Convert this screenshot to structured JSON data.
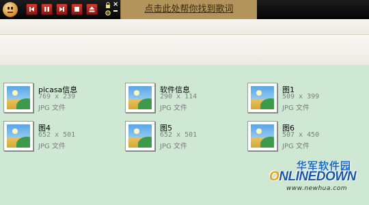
{
  "player": {
    "logo_icon": "player-mascot-icon",
    "buttons": [
      {
        "name": "prev-track-button",
        "icon": "skip-back-icon"
      },
      {
        "name": "pause-button",
        "icon": "pause-icon"
      },
      {
        "name": "next-track-button",
        "icon": "skip-forward-icon"
      },
      {
        "name": "stop-button",
        "icon": "stop-icon"
      },
      {
        "name": "eject-button",
        "icon": "eject-icon"
      }
    ],
    "promo_text": "点击此处帮你找到歌词",
    "accent_color": "#c8281c"
  },
  "files": [
    {
      "name": "picasa信息",
      "dims": "769 x 239",
      "type": "JPG 文件"
    },
    {
      "name": "软件信息",
      "dims": "290 x 114",
      "type": "JPG 文件"
    },
    {
      "name": "图1",
      "dims": "509 x 399",
      "type": "JPG 文件"
    },
    {
      "name": "图4",
      "dims": "652 x 501",
      "type": "JPG 文件"
    },
    {
      "name": "图5",
      "dims": "652 x 501",
      "type": "JPG 文件"
    },
    {
      "name": "图6",
      "dims": "507 x 450",
      "type": "JPG 文件"
    }
  ],
  "watermark": {
    "cn": "华军软件园",
    "logo": "NLINEDOWN",
    "logo_o": "O",
    "url": "www.newhua.com"
  }
}
